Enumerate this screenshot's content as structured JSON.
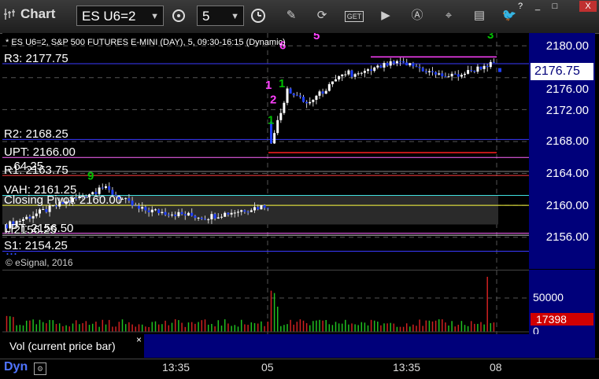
{
  "app": {
    "title": "Chart"
  },
  "toolbar": {
    "symbol": "ES U6=2",
    "interval": "5",
    "buttons": [
      "link-settings-icon",
      "clock-icon",
      "pencil-icon",
      "refresh-icon",
      "quote-icon",
      "play-icon",
      "alert-icon",
      "cursor-icon",
      "chat-icon",
      "twitter-icon"
    ]
  },
  "window": {
    "help": "?",
    "minimize": "_",
    "maximize": "□",
    "close": "X"
  },
  "chart": {
    "header": "* ES U6=2, S&P 500 FUTURES E-MINI (DAY), 5, 09:30-16:15 (Dynamic)",
    "copyright": "© eSignal, 2016",
    "watermark": "...",
    "levels": [
      {
        "label": "R3: 2177.75",
        "value": 2177.75,
        "color": "#3a3aff"
      },
      {
        "label": "R2: 2168.25",
        "value": 2168.25,
        "color": "#3a3aff"
      },
      {
        "label": "UPT: 2166.00",
        "value": 2166.0,
        "color": "#ff66ff"
      },
      {
        "label": "...64.25",
        "value": 2164.25,
        "color": "#888888"
      },
      {
        "label": "R1: 2163.75",
        "value": 2163.75,
        "color": "#ff4040"
      },
      {
        "label": "VAH: 2161.25",
        "value": 2161.25,
        "color": "#40e0e0"
      },
      {
        "label": "Closing Pivot: 2160.00",
        "value": 2160.0,
        "color": "#ffff40"
      },
      {
        "label": "LPT: 2156.50",
        "value": 2156.5,
        "color": "#ff66ff"
      },
      {
        "label": "...2156.25",
        "value": 2156.25,
        "color": "#cccccc"
      },
      {
        "label": "S1: 2154.25",
        "value": 2154.25,
        "color": "#3a3aff"
      }
    ],
    "markers": [
      "1",
      "2",
      "1",
      "1",
      "6",
      "5",
      "1011",
      "3",
      "9"
    ],
    "price_axis": [
      "2180.00",
      "2176.00",
      "2172.00",
      "2168.00",
      "2164.00",
      "2160.00",
      "2156.00"
    ],
    "last_price": "2176.75"
  },
  "volume": {
    "legend": "Vol (current price bar)",
    "close": "×",
    "axis": [
      "50000",
      "0"
    ],
    "last": "17398"
  },
  "timeaxis": {
    "mode": "Dyn",
    "labels": [
      "13:35",
      "05",
      "13:35",
      "08"
    ]
  },
  "chart_data": {
    "type": "candlestick",
    "series": [
      {
        "name": "ES U6=2",
        "values": []
      }
    ],
    "ylim": [
      2152,
      2182
    ],
    "x_ticks": [
      "13:35",
      "05",
      "13:35",
      "08"
    ]
  }
}
